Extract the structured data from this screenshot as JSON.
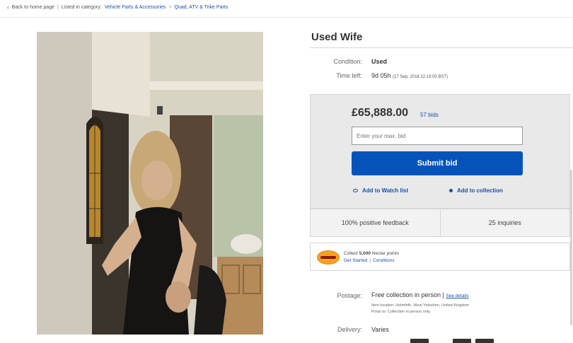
{
  "breadcrumb": {
    "back_label": "Back to home page",
    "listed_label": "Listed in category:",
    "cat1": "Vehicle Parts & Accessories",
    "sep": ">",
    "cat2": "Quad, ATV & Trike Parts"
  },
  "item": {
    "title": "Used Wife",
    "condition_label": "Condition:",
    "condition_value": "Used",
    "time_left_label": "Time left:",
    "time_left_value": "9d 05h",
    "time_left_detail": "(17 Sep, 2016   22:19:00 BST)"
  },
  "bid": {
    "price": "£65,888.00",
    "bids": "57 bids",
    "max_bid_placeholder": "Enter your max. bid",
    "submit_label": "Submit bid",
    "watch_label": "Add to Watch list",
    "collection_label": "Add to collection"
  },
  "stats": {
    "feedback": "100% positive feedback",
    "inquiries": "25 inquiries"
  },
  "nectar": {
    "collect_prefix": "Collect",
    "points": "5,000",
    "collect_suffix": "Nectar points",
    "get_started": "Get Started",
    "bar": "|",
    "conditions": "Conditions"
  },
  "shipping": {
    "postage_label": "Postage:",
    "postage_value": "Free collection in person |",
    "see_details": "See details",
    "item_location": "Item location:   Holmfirth, West Yorkshire, United Kingdom",
    "posts_to": "Posts to:   Collection in person only",
    "delivery_label": "Delivery:",
    "delivery_value": "Varies"
  },
  "colors": {
    "accent_blue": "#0654ba",
    "link_blue": "#1b4fa8",
    "nectar_orange": "#f7a21b"
  },
  "icons": {
    "back": "chevron-left-icon",
    "watch": "eye-icon",
    "collection": "dot-icon",
    "nectar": "nectar-logo"
  }
}
